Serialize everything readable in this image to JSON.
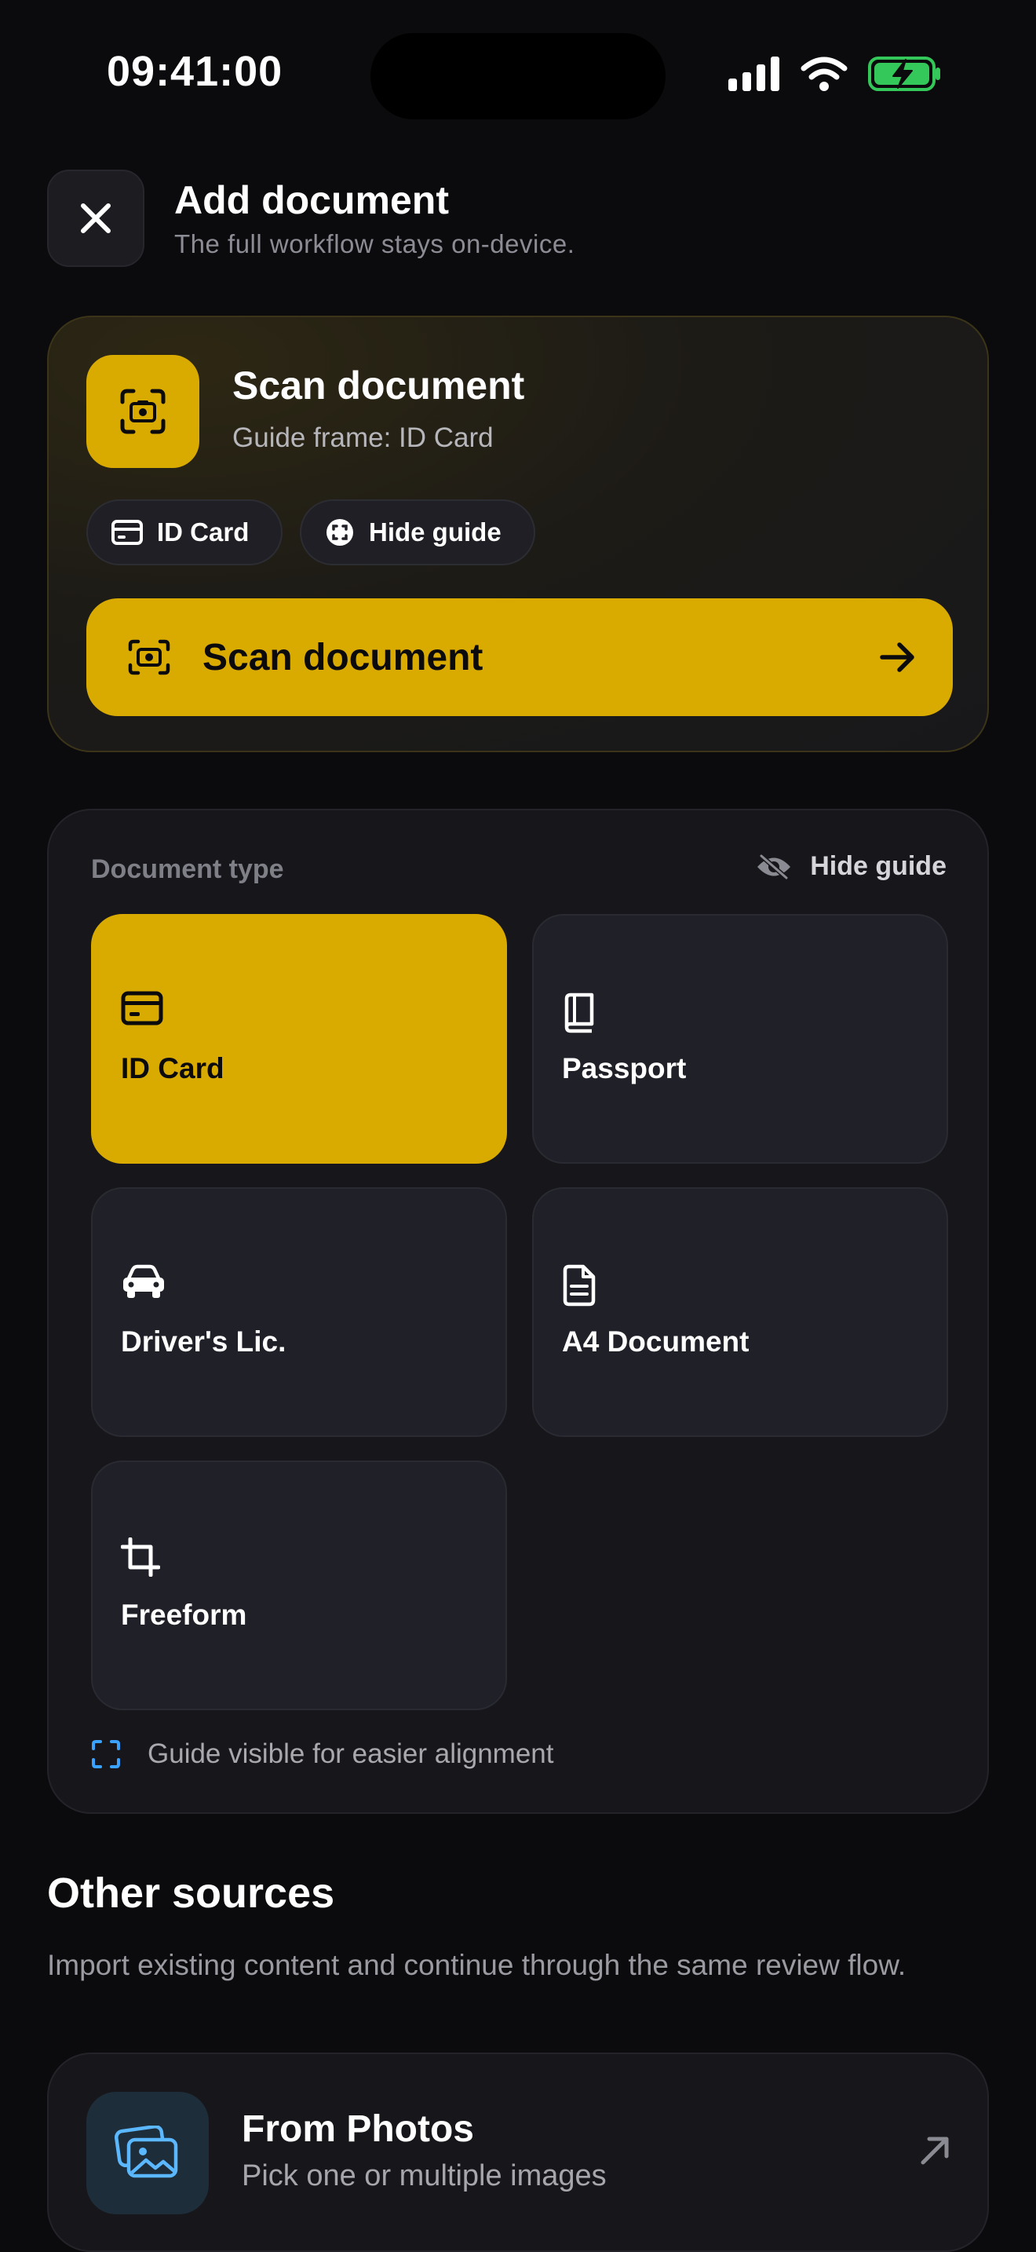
{
  "status_bar": {
    "time": "09:41:00"
  },
  "header": {
    "title": "Add document",
    "subtitle": "The full workflow stays on-device."
  },
  "scan_card": {
    "title": "Scan document",
    "subtitle": "Guide frame: ID Card",
    "chips": [
      {
        "label": "ID Card",
        "icon": "card-icon"
      },
      {
        "label": "Hide guide",
        "icon": "guide-icon"
      }
    ],
    "button_label": "Scan document"
  },
  "document_type": {
    "label": "Document type",
    "toggle_label": "Hide guide",
    "types": [
      {
        "label": "ID Card",
        "icon": "card-icon",
        "selected": true
      },
      {
        "label": "Passport",
        "icon": "book-icon",
        "selected": false
      },
      {
        "label": "Driver's Lic.",
        "icon": "car-icon",
        "selected": false
      },
      {
        "label": "A4 Document",
        "icon": "file-icon",
        "selected": false
      },
      {
        "label": "Freeform",
        "icon": "crop-icon",
        "selected": false
      }
    ],
    "hint": "Guide visible for easier alignment"
  },
  "other_sources": {
    "title": "Other sources",
    "description": "Import existing content and continue through the same review flow.",
    "items": [
      {
        "title": "From Photos",
        "subtitle": "Pick one or multiple images",
        "icon": "photos-icon"
      }
    ]
  },
  "colors": {
    "accent": "#d9aa00",
    "background": "#0b0b0d",
    "card": "#17171b",
    "battery": "#34c759",
    "hint_icon": "#3aa3ff"
  }
}
